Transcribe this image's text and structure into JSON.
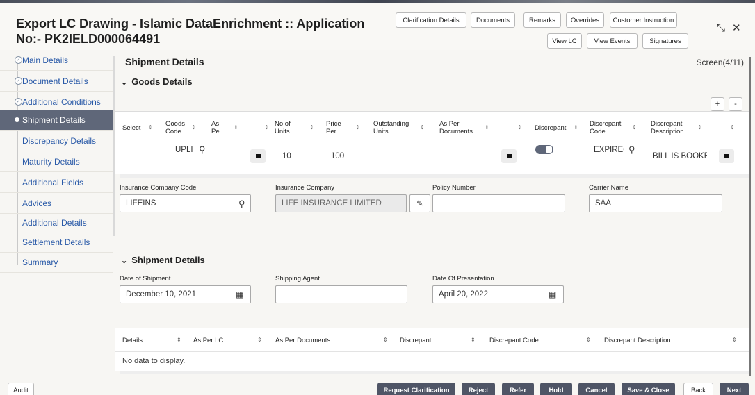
{
  "header": {
    "title": "Export LC Drawing - Islamic DataEnrichment :: Application No:- PK2IELD000064491",
    "buttons_row1": [
      "Clarification Details",
      "Documents",
      "Remarks",
      "Overrides",
      "Customer Instruction"
    ],
    "buttons_row2": [
      "View LC",
      "View Events",
      "Signatures"
    ],
    "controls": {
      "restore": "⤡",
      "close": "✕"
    }
  },
  "sidebar": {
    "items": [
      {
        "label": "Main Details",
        "state": "done"
      },
      {
        "label": "Document Details",
        "state": "done"
      },
      {
        "label": "Additional Conditions",
        "state": "done"
      },
      {
        "label": "Shipment Details",
        "state": "active"
      },
      {
        "label": "Discrepancy Details",
        "state": "pending"
      },
      {
        "label": "Maturity Details",
        "state": "pending"
      },
      {
        "label": "Additional Fields",
        "state": "pending"
      },
      {
        "label": "Advices",
        "state": "pending"
      },
      {
        "label": "Additional Details",
        "state": "pending"
      },
      {
        "label": "Settlement Details",
        "state": "pending"
      },
      {
        "label": "Summary",
        "state": "pending"
      }
    ]
  },
  "main": {
    "section_title": "Shipment Details",
    "screen_label": "Screen(4/11)",
    "goods": {
      "title": "Goods Details",
      "add_label": "+",
      "remove_label": "-",
      "columns": [
        "Select",
        "Goods Code",
        "As Pe...",
        "",
        "No of Units",
        "Price Per...",
        "Outstanding Units",
        "As Per Documents",
        "",
        "Discrepant",
        "Discrepant Code",
        "Discrepant Description",
        ""
      ],
      "row": {
        "goods_code": "UPLI",
        "no_of_units": "10",
        "price_per": "100",
        "discrepant_code": "EXPIREC",
        "discrepant_description": "BILL IS BOOKEC"
      }
    },
    "insurance": {
      "company_code_label": "Insurance Company Code",
      "company_code_value": "LIFEINS",
      "company_label": "Insurance Company",
      "company_value": "LIFE INSURANCE LIMITED",
      "policy_label": "Policy Number",
      "policy_value": "",
      "carrier_label": "Carrier Name",
      "carrier_value": "SAA"
    },
    "shipment": {
      "title": "Shipment Details",
      "date_of_shipment_label": "Date of Shipment",
      "date_of_shipment_value": "December 10, 2021",
      "shipping_agent_label": "Shipping Agent",
      "shipping_agent_value": "",
      "date_of_presentation_label": "Date Of Presentation",
      "date_of_presentation_value": "April 20, 2022",
      "columns": [
        "Details",
        "As Per LC",
        "As Per Documents",
        "Discrepant",
        "Discrepant Code",
        "Discrepant Description"
      ],
      "empty_text": "No data to display."
    }
  },
  "footer": {
    "audit": "Audit",
    "buttons": [
      "Request Clarification",
      "Reject",
      "Refer",
      "Hold",
      "Cancel",
      "Save & Close",
      "Back",
      "Next"
    ]
  }
}
